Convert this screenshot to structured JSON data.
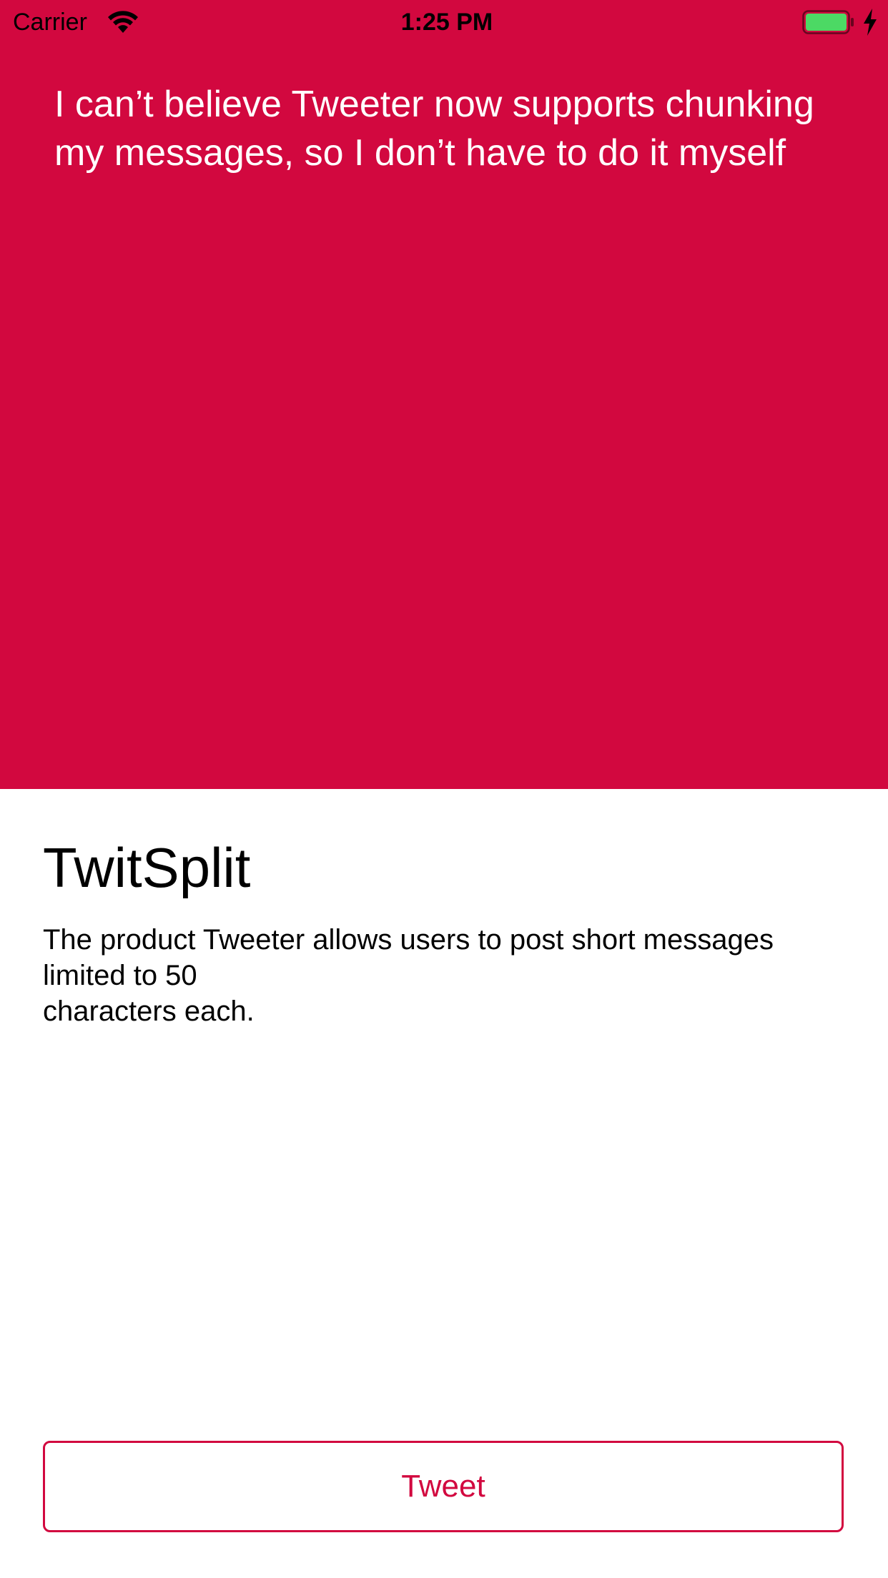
{
  "status_bar": {
    "carrier": "Carrier",
    "time": "1:25 PM",
    "icons": [
      "wifi-icon",
      "battery-icon",
      "charging-bolt-icon"
    ],
    "battery_color": "#4CD964"
  },
  "message": {
    "text": "I can’t believe Tweeter now supports chunking my messages, so I don’t have to do it myself"
  },
  "app": {
    "title": "TwitSplit",
    "description": "The product Tweeter allows users to post short messages limited to 50\ncharacters each."
  },
  "actions": {
    "tweet_label": "Tweet"
  },
  "colors": {
    "accent": "#D2083F",
    "background": "#FFFFFF",
    "text": "#000000",
    "message_text": "#FFFFFF"
  }
}
